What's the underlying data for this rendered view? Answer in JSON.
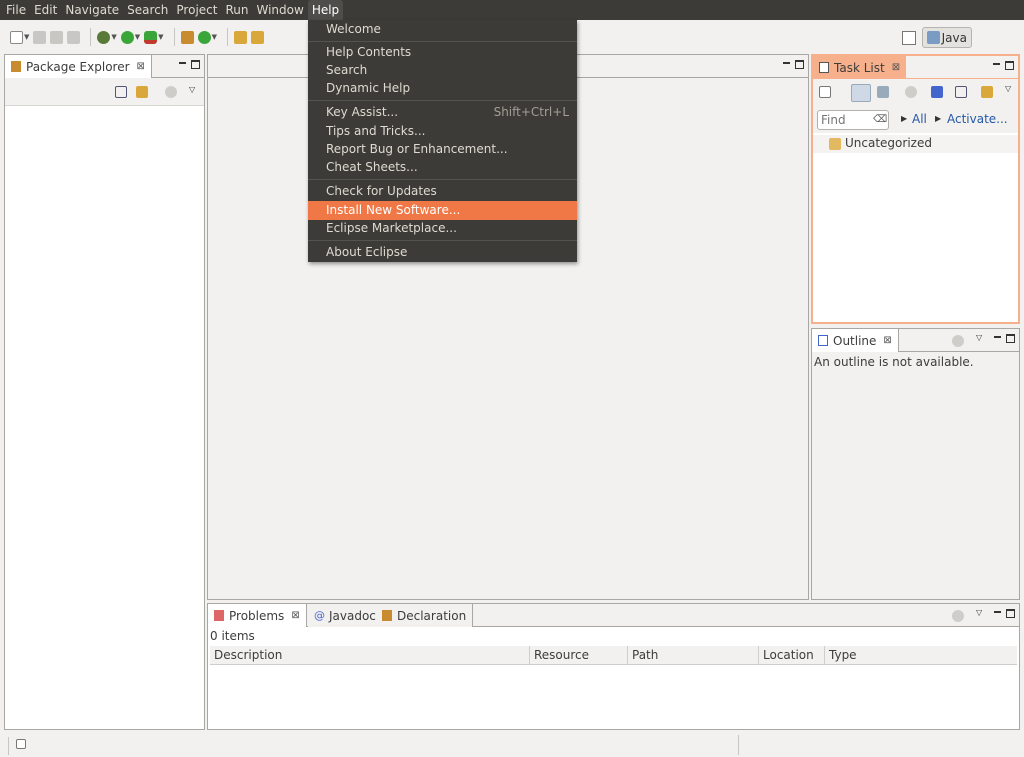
{
  "menubar": {
    "items": [
      "File",
      "Edit",
      "Navigate",
      "Search",
      "Project",
      "Run",
      "Window",
      "Help"
    ]
  },
  "perspective": {
    "java_label": "Java"
  },
  "package_explorer": {
    "title": "Package Explorer"
  },
  "task_list": {
    "title": "Task List",
    "find_placeholder": "Find",
    "all_label": "All",
    "activate_label": "Activate...",
    "category": "Uncategorized"
  },
  "outline": {
    "title": "Outline",
    "message": "An outline is not available."
  },
  "bottom": {
    "tabs": [
      "Problems",
      "Javadoc",
      "Declaration"
    ],
    "count": "0 items",
    "columns": [
      "Description",
      "Resource",
      "Path",
      "Location",
      "Type"
    ]
  },
  "help_menu": {
    "items": [
      {
        "label": "Welcome"
      },
      {
        "label": "Help Contents"
      },
      {
        "label": "Search"
      },
      {
        "label": "Dynamic Help"
      },
      {
        "label": "Key Assist...",
        "accel": "Shift+Ctrl+L"
      },
      {
        "label": "Tips and Tricks..."
      },
      {
        "label": "Report Bug or Enhancement..."
      },
      {
        "label": "Cheat Sheets..."
      },
      {
        "label": "Check for Updates"
      },
      {
        "label": "Install New Software..."
      },
      {
        "label": "Eclipse Marketplace..."
      },
      {
        "label": "About Eclipse"
      }
    ]
  },
  "colors": {
    "menubar_bg": "#3c3b37",
    "highlight": "#f07746",
    "active_tab": "#f7b08c",
    "link": "#2458a6"
  }
}
